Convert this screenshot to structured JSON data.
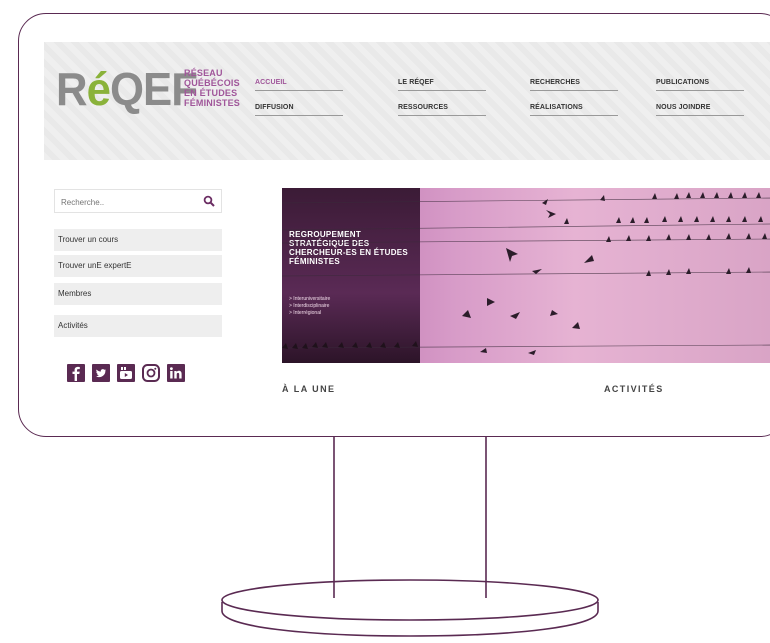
{
  "logo": {
    "main_prefix": "R",
    "main_accent": "é",
    "main_suffix": "QEF",
    "subtitle_lines": [
      "RÉSEAU",
      "QUÉBÉCOIS",
      "EN ÉTUDES",
      "FÉMINISTES"
    ]
  },
  "nav": {
    "items": [
      {
        "label": "ACCUEIL",
        "active": true
      },
      {
        "label": "LE RÉQEF",
        "active": false
      },
      {
        "label": "RECHERCHES",
        "active": false
      },
      {
        "label": "PUBLICATIONS",
        "active": false
      },
      {
        "label": "DIFFUSION",
        "active": false
      },
      {
        "label": "RESSOURCES",
        "active": false
      },
      {
        "label": "RÉALISATIONS",
        "active": false
      },
      {
        "label": "NOUS JOINDRE",
        "active": false
      }
    ]
  },
  "search": {
    "placeholder": "Recherche..",
    "icon": "search-icon"
  },
  "sidebar": {
    "items": [
      {
        "label": "Trouver un cours"
      },
      {
        "label": "Trouver unE expertE"
      },
      {
        "label": "Membres"
      },
      {
        "label": "Activités"
      }
    ]
  },
  "social": {
    "icons": [
      "facebook-icon",
      "twitter-icon",
      "youtube-icon",
      "instagram-icon",
      "linkedin-icon"
    ],
    "color": "#5a2a52"
  },
  "banner": {
    "title": "REGROUPEMENT STRATÉGIQUE DES CHERCHEUR-ES EN ÉTUDES FÉMINISTES",
    "tags": [
      "> Interuniversitaire",
      "> Interdisciplinaire",
      "> Interrégional"
    ]
  },
  "sections": {
    "a_la_une": "À LA UNE",
    "activites": "ACTIVITÉS"
  },
  "colors": {
    "frame": "#5a2a52",
    "accent_purple": "#a0569a",
    "logo_green": "#8ab23a",
    "logo_gray": "#8b8b8b"
  }
}
